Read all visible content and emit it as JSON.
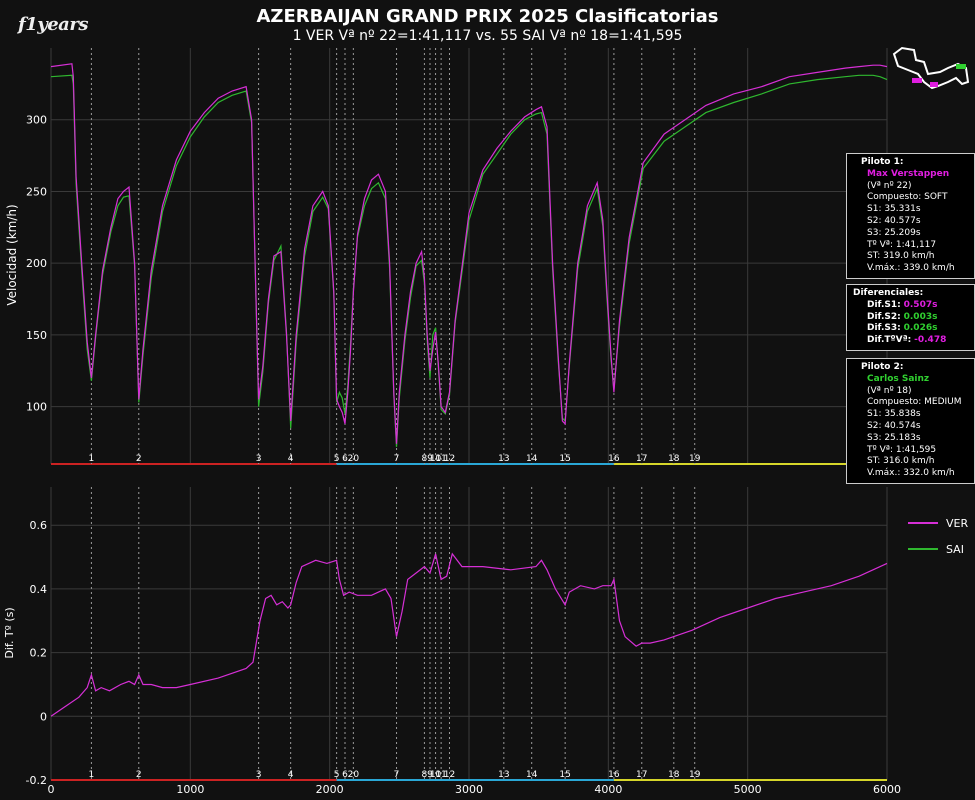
{
  "header": {
    "logo_text": "f1years",
    "title": "AZERBAIJAN GRAND PRIX 2025 Clasificatorias",
    "subtitle": "1 VER Vª nº  22=1:41,117 vs. 55 SAI Vª nº  18=1:41,595"
  },
  "colors": {
    "background": "#111111",
    "ver": "#d62fd6",
    "sai": "#2fb82f",
    "grid": "#3a3a3a",
    "sector1": "#cc2222",
    "sector2": "#2aa7d6",
    "sector3": "#d6d62a",
    "corner_line": "#9a9a9a"
  },
  "piloto1": {
    "header": "Piloto 1:",
    "name": "Max Verstappen",
    "lap": "(Vª nº 22)",
    "compound": "Compuesto: SOFT",
    "s1": "S1: 35.331s",
    "s2": "S2: 40.577s",
    "s3": "S3: 25.209s",
    "lap_time": "Tº Vª: 1:41,117",
    "st": "ST: 319.0 km/h",
    "vmax": "V.máx.: 339.0 km/h"
  },
  "diferenciales": {
    "header": "Diferenciales:",
    "s1_label": "Dif.S1:",
    "s1_value": "0.507s",
    "s2_label": "Dif.S2:",
    "s2_value": "0.003s",
    "s3_label": "Dif.S3:",
    "s3_value": "0.026s",
    "lap_label": "Dif.TºVª:",
    "lap_value": "-0.478"
  },
  "piloto2": {
    "header": "Piloto 2:",
    "name": "Carlos Sainz",
    "lap": "(Vª nº 18)",
    "compound": "Compuesto: MEDIUM",
    "s1": "S1: 35.838s",
    "s2": "S2: 40.574s",
    "s3": "S3: 25.183s",
    "lap_time": "Tº Vª: 1:41,595",
    "st": "ST: 316.0 km/h",
    "vmax": "V.máx.: 332.0 km/h"
  },
  "legend": [
    {
      "name": "VER",
      "color": "#d62fd6"
    },
    {
      "name": "SAI",
      "color": "#2fb82f"
    }
  ],
  "chart_data": [
    {
      "type": "line",
      "ylabel": "Velocidad (km/h)",
      "xlim": [
        0,
        6000
      ],
      "ylim": [
        60,
        350
      ],
      "yticks": [
        100,
        150,
        200,
        250,
        300
      ],
      "corners": [
        {
          "label": "1",
          "x": 290
        },
        {
          "label": "2",
          "x": 630
        },
        {
          "label": "3",
          "x": 1490
        },
        {
          "label": "4",
          "x": 1720
        },
        {
          "label": "5",
          "x": 2050
        },
        {
          "label": "6",
          "x": 2110
        },
        {
          "label": "20",
          "x": 2170
        },
        {
          "label": "7",
          "x": 2480
        },
        {
          "label": "8",
          "x": 2680
        },
        {
          "label": "9",
          "x": 2720
        },
        {
          "label": "10",
          "x": 2760
        },
        {
          "label": "11",
          "x": 2800
        },
        {
          "label": "12",
          "x": 2860
        },
        {
          "label": "13",
          "x": 3250
        },
        {
          "label": "14",
          "x": 3450
        },
        {
          "label": "15",
          "x": 3690
        },
        {
          "label": "16",
          "x": 4040
        },
        {
          "label": "17",
          "x": 4240
        },
        {
          "label": "18",
          "x": 4470
        },
        {
          "label": "19",
          "x": 4620
        }
      ],
      "sectors": [
        {
          "name": "S1",
          "from": 0,
          "to": 2050
        },
        {
          "name": "S2",
          "from": 2050,
          "to": 4040
        },
        {
          "name": "S3",
          "from": 4040,
          "to": 6000
        }
      ],
      "series": [
        {
          "name": "VER",
          "x": [
            0,
            150,
            160,
            180,
            220,
            260,
            290,
            320,
            370,
            430,
            480,
            520,
            560,
            600,
            630,
            660,
            720,
            800,
            900,
            1000,
            1100,
            1200,
            1300,
            1400,
            1440,
            1460,
            1490,
            1520,
            1560,
            1600,
            1650,
            1690,
            1720,
            1760,
            1820,
            1880,
            1950,
            1990,
            2030,
            2050,
            2070,
            2090,
            2110,
            2130,
            2150,
            2170,
            2200,
            2250,
            2300,
            2350,
            2400,
            2430,
            2460,
            2480,
            2500,
            2540,
            2580,
            2620,
            2660,
            2680,
            2700,
            2720,
            2740,
            2760,
            2780,
            2800,
            2830,
            2860,
            2900,
            3000,
            3100,
            3200,
            3300,
            3400,
            3480,
            3520,
            3560,
            3600,
            3640,
            3670,
            3690,
            3720,
            3780,
            3850,
            3920,
            3960,
            3990,
            4020,
            4040,
            4080,
            4150,
            4250,
            4400,
            4550,
            4700,
            4900,
            5100,
            5300,
            5500,
            5700,
            5800,
            5900,
            5950,
            6000
          ],
          "y": [
            337,
            339,
            330,
            260,
            200,
            145,
            120,
            150,
            195,
            225,
            245,
            250,
            253,
            200,
            105,
            140,
            195,
            240,
            272,
            292,
            305,
            315,
            320,
            323,
            300,
            220,
            105,
            128,
            175,
            205,
            208,
            150,
            90,
            150,
            210,
            240,
            250,
            240,
            180,
            105,
            100,
            96,
            88,
            110,
            140,
            180,
            220,
            245,
            258,
            262,
            250,
            200,
            110,
            74,
            110,
            150,
            180,
            200,
            208,
            190,
            150,
            125,
            140,
            152,
            130,
            100,
            96,
            110,
            160,
            235,
            265,
            280,
            292,
            302,
            307,
            309,
            295,
            200,
            135,
            90,
            88,
            130,
            200,
            240,
            256,
            230,
            180,
            135,
            110,
            160,
            218,
            270,
            290,
            300,
            310,
            318,
            323,
            330,
            333,
            336,
            337,
            338,
            338,
            337
          ]
        },
        {
          "name": "SAI",
          "x": [
            0,
            150,
            160,
            180,
            220,
            260,
            290,
            320,
            370,
            430,
            480,
            520,
            560,
            600,
            630,
            660,
            720,
            800,
            900,
            1000,
            1100,
            1200,
            1300,
            1400,
            1440,
            1460,
            1490,
            1520,
            1560,
            1600,
            1650,
            1690,
            1720,
            1760,
            1820,
            1880,
            1950,
            1990,
            2030,
            2050,
            2070,
            2090,
            2110,
            2130,
            2150,
            2170,
            2200,
            2250,
            2300,
            2350,
            2400,
            2430,
            2460,
            2480,
            2500,
            2540,
            2580,
            2620,
            2660,
            2680,
            2700,
            2720,
            2740,
            2760,
            2780,
            2800,
            2830,
            2860,
            2900,
            3000,
            3100,
            3200,
            3300,
            3400,
            3480,
            3520,
            3560,
            3600,
            3640,
            3670,
            3690,
            3720,
            3780,
            3850,
            3920,
            3960,
            3990,
            4020,
            4040,
            4080,
            4150,
            4250,
            4400,
            4550,
            4700,
            4900,
            5100,
            5300,
            5500,
            5700,
            5800,
            5900,
            5950,
            6000
          ],
          "y": [
            330,
            331,
            325,
            255,
            195,
            140,
            118,
            148,
            192,
            222,
            240,
            246,
            247,
            198,
            103,
            136,
            190,
            236,
            268,
            288,
            302,
            312,
            317,
            320,
            298,
            218,
            100,
            124,
            172,
            202,
            212,
            152,
            85,
            145,
            205,
            236,
            246,
            238,
            178,
            103,
            110,
            106,
            95,
            115,
            145,
            182,
            218,
            240,
            252,
            256,
            245,
            196,
            108,
            72,
            106,
            146,
            176,
            198,
            202,
            186,
            146,
            120,
            150,
            155,
            128,
            98,
            95,
            108,
            158,
            230,
            262,
            276,
            290,
            300,
            304,
            305,
            290,
            196,
            132,
            92,
            90,
            128,
            196,
            236,
            252,
            226,
            176,
            132,
            112,
            156,
            214,
            266,
            285,
            295,
            305,
            312,
            318,
            325,
            328,
            330,
            331,
            331,
            330,
            328
          ]
        }
      ]
    },
    {
      "type": "line",
      "ylabel": "Dif. Tº (s)",
      "xlim": [
        0,
        6000
      ],
      "ylim": [
        -0.2,
        0.72
      ],
      "xticks": [
        0,
        1000,
        2000,
        3000,
        4000,
        5000,
        6000
      ],
      "yticks": [
        -0.2,
        0,
        0.2,
        0.4,
        0.6
      ],
      "series": [
        {
          "name": "VER",
          "x": [
            0,
            100,
            200,
            260,
            290,
            320,
            360,
            420,
            500,
            560,
            600,
            630,
            660,
            720,
            800,
            900,
            1000,
            1200,
            1400,
            1450,
            1500,
            1540,
            1580,
            1620,
            1660,
            1700,
            1720,
            1760,
            1800,
            1900,
            1980,
            2050,
            2070,
            2100,
            2140,
            2200,
            2300,
            2400,
            2440,
            2480,
            2520,
            2560,
            2620,
            2680,
            2720,
            2760,
            2800,
            2840,
            2880,
            2950,
            3100,
            3300,
            3480,
            3520,
            3560,
            3620,
            3690,
            3720,
            3800,
            3900,
            3960,
            4020,
            4040,
            4080,
            4120,
            4200,
            4240,
            4300,
            4400,
            4600,
            4800,
            5000,
            5200,
            5400,
            5600,
            5800,
            6000
          ],
          "y": [
            0,
            0.03,
            0.06,
            0.09,
            0.13,
            0.08,
            0.09,
            0.08,
            0.1,
            0.11,
            0.1,
            0.13,
            0.1,
            0.1,
            0.09,
            0.09,
            0.1,
            0.12,
            0.15,
            0.17,
            0.3,
            0.37,
            0.38,
            0.35,
            0.36,
            0.34,
            0.35,
            0.42,
            0.47,
            0.49,
            0.48,
            0.49,
            0.43,
            0.38,
            0.39,
            0.38,
            0.38,
            0.4,
            0.37,
            0.25,
            0.33,
            0.43,
            0.45,
            0.47,
            0.45,
            0.51,
            0.43,
            0.44,
            0.51,
            0.47,
            0.47,
            0.46,
            0.47,
            0.49,
            0.46,
            0.4,
            0.35,
            0.39,
            0.41,
            0.4,
            0.41,
            0.41,
            0.43,
            0.3,
            0.25,
            0.22,
            0.23,
            0.23,
            0.24,
            0.27,
            0.31,
            0.34,
            0.37,
            0.39,
            0.41,
            0.44,
            0.48
          ]
        }
      ]
    }
  ]
}
